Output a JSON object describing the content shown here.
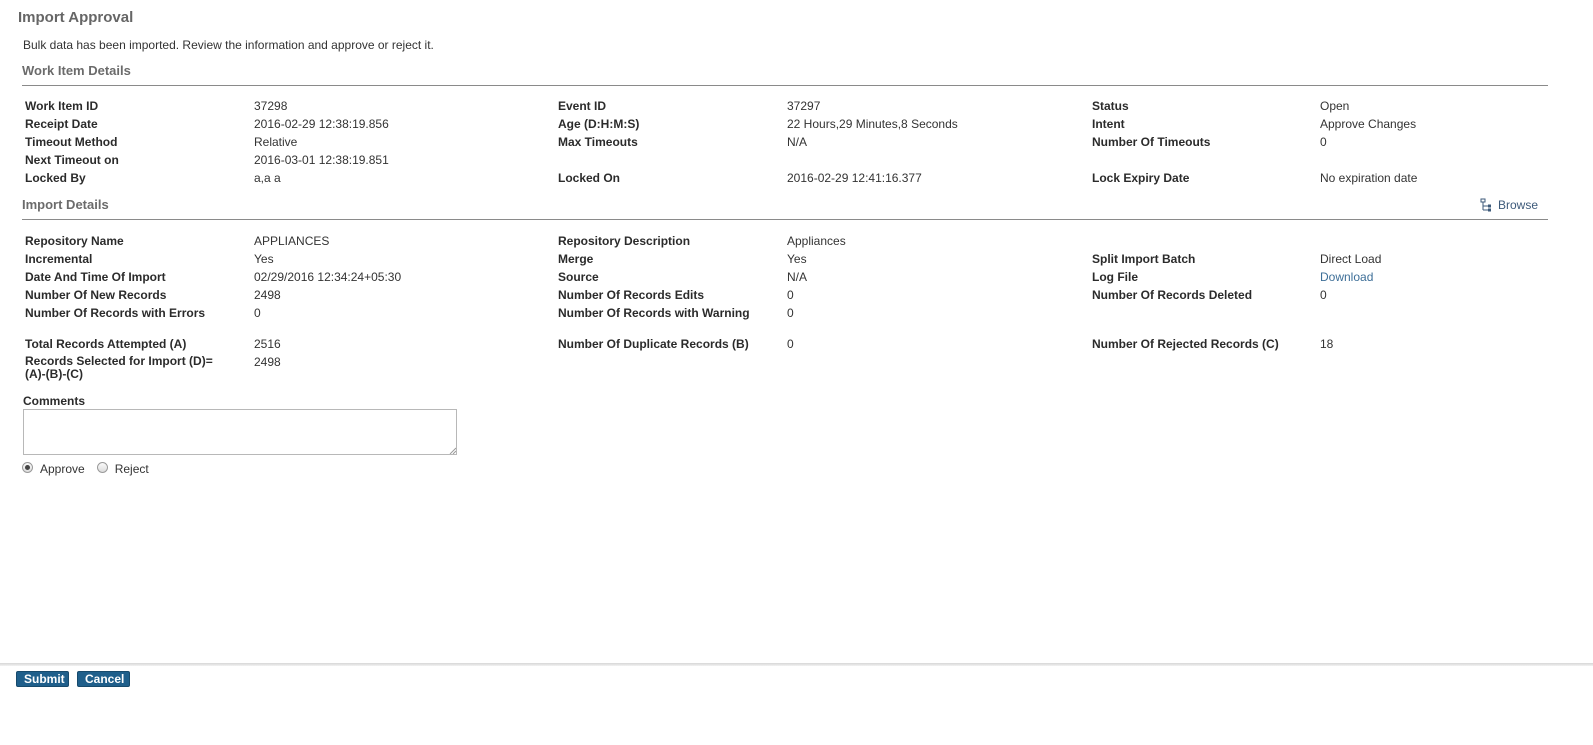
{
  "page": {
    "title": "Import Approval",
    "description": "Bulk data has been imported. Review the information and approve or reject it."
  },
  "work_item": {
    "section_title": "Work Item Details",
    "fields": {
      "work_item_id": {
        "label": "Work Item ID",
        "value": "37298"
      },
      "event_id": {
        "label": "Event ID",
        "value": "37297"
      },
      "status": {
        "label": "Status",
        "value": "Open"
      },
      "receipt_date": {
        "label": "Receipt Date",
        "value": "2016-02-29 12:38:19.856"
      },
      "age": {
        "label": "Age (D:H:M:S)",
        "value": "22 Hours,29 Minutes,8 Seconds"
      },
      "intent": {
        "label": "Intent",
        "value": "Approve Changes"
      },
      "timeout_method": {
        "label": "Timeout Method",
        "value": "Relative"
      },
      "max_timeouts": {
        "label": "Max Timeouts",
        "value": "N/A"
      },
      "number_of_timeouts": {
        "label": "Number Of Timeouts",
        "value": "0"
      },
      "next_timeout_on": {
        "label": "Next Timeout on",
        "value": "2016-03-01 12:38:19.851"
      },
      "locked_by": {
        "label": "Locked By",
        "value": "a,a a"
      },
      "locked_on": {
        "label": "Locked On",
        "value": "2016-02-29 12:41:16.377"
      },
      "lock_expiry_date": {
        "label": "Lock Expiry Date",
        "value": "No expiration date"
      }
    }
  },
  "import_details": {
    "section_title": "Import Details",
    "browse_label": "Browse",
    "fields": {
      "repository_name": {
        "label": "Repository Name",
        "value": "APPLIANCES"
      },
      "repository_description": {
        "label": "Repository Description",
        "value": "Appliances"
      },
      "incremental": {
        "label": "Incremental",
        "value": "Yes"
      },
      "merge": {
        "label": "Merge",
        "value": "Yes"
      },
      "split_import_batch": {
        "label": "Split Import Batch",
        "value": "Direct Load"
      },
      "date_time_of_import": {
        "label": "Date And Time Of Import",
        "value": "02/29/2016 12:34:24+05:30"
      },
      "source": {
        "label": "Source",
        "value": "N/A"
      },
      "log_file": {
        "label": "Log File",
        "value": "Download"
      },
      "new_records": {
        "label": "Number Of New Records",
        "value": "2498"
      },
      "records_edits": {
        "label": "Number Of Records Edits",
        "value": "0"
      },
      "records_deleted": {
        "label": "Number Of Records Deleted",
        "value": "0"
      },
      "records_errors": {
        "label": "Number Of Records with Errors",
        "value": "0"
      },
      "records_warning": {
        "label": "Number Of Records with Warning",
        "value": "0"
      },
      "total_attempted": {
        "label": "Total Records Attempted (A)",
        "value": "2516"
      },
      "duplicate_records": {
        "label": "Number Of Duplicate Records (B)",
        "value": "0"
      },
      "rejected_records": {
        "label": "Number Of Rejected Records (C)",
        "value": "18"
      },
      "selected_for_import": {
        "label": "Records Selected for Import (D)= (A)-(B)-(C)",
        "value": "2498"
      }
    }
  },
  "comments": {
    "label": "Comments",
    "value": ""
  },
  "decision": {
    "approve_label": "Approve",
    "reject_label": "Reject",
    "selected": "Approve"
  },
  "footer": {
    "submit_label": "Submit",
    "cancel_label": "Cancel"
  },
  "colors": {
    "button_bg": "#1f5f8b",
    "link": "#3e6f98",
    "section_title": "#6b6b6b"
  },
  "icons": {
    "browse": "browse-tree-icon"
  }
}
